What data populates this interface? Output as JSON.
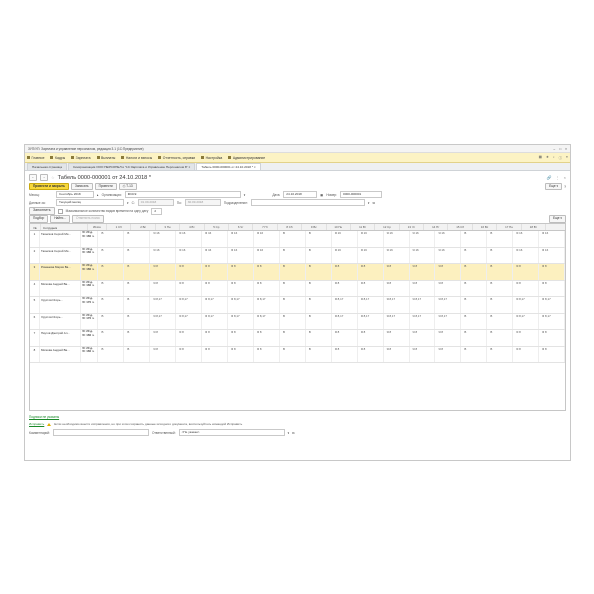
{
  "window": {
    "title": "ЗУП/УП: Зарплата и управление персоналом, редакция 3.1 (1С:Предприятие)"
  },
  "menu": [
    {
      "label": "Главное",
      "icon": "home-icon"
    },
    {
      "label": "Кадры",
      "icon": "people-icon"
    },
    {
      "label": "Зарплата",
      "icon": "wallet-icon"
    },
    {
      "label": "Выплаты",
      "icon": "payment-icon"
    },
    {
      "label": "Налоги и взносы",
      "icon": "tax-icon"
    },
    {
      "label": "Отчетность, справки",
      "icon": "report-icon"
    },
    {
      "label": "Настройка",
      "icon": "wrench-icon"
    },
    {
      "label": "Администрирование",
      "icon": "gear-icon"
    }
  ],
  "tabs": [
    {
      "label": "Начальная страница"
    },
    {
      "label": "Синхронизация ООО ПЕРСОНЕЛ и \"1С:Зарплата и Управление Персоналом 8\" ×"
    },
    {
      "label": "Табель 0000-000001 от 24.10.2018 * ×"
    }
  ],
  "doc": {
    "title": "Табель 0000-000001 от 24.10.2018 *"
  },
  "toolbar": {
    "post_close": "Провести и закрыть",
    "save": "Записать",
    "post": "Провести",
    "t13": "Т-13",
    "more": "Еще"
  },
  "form": {
    "month_label": "Месяц:",
    "month_value": "Сентябрь 2018",
    "org_label": "Организация:",
    "org_value": "ФСКЭ",
    "date_label": "Дата:",
    "date_value": "24.10.2018",
    "number_label": "Номер:",
    "number_value": "0000-000001",
    "data_for_label": "Данные за:",
    "data_for_value": "Текущий месяц",
    "from_label": "С:",
    "from_value": "01.09.2018",
    "to_label": "По:",
    "to_value": "30.09.2018",
    "dept_label": "Подразделение:"
  },
  "fill": {
    "button": "Заполнить",
    "hint": "Максимальное количество видов времени на одну дату"
  },
  "table_tools": {
    "pick": "Подбор",
    "find": "Найти...",
    "cancel_search": "Отменить поиск",
    "more": "Еще"
  },
  "table": {
    "headers": [
      "№",
      "Сотрудник",
      "Итого"
    ],
    "days": [
      {
        "label": "1 Сб",
        "weekend": true
      },
      {
        "label": "2 Вс",
        "weekend": true
      },
      {
        "label": "3 Пн",
        "weekend": false
      },
      {
        "label": "4 Вт",
        "weekend": false
      },
      {
        "label": "5 Ср",
        "weekend": false
      },
      {
        "label": "6 Чт",
        "weekend": false
      },
      {
        "label": "7 Пт",
        "weekend": false
      },
      {
        "label": "8 Сб",
        "weekend": true
      },
      {
        "label": "9 Вс",
        "weekend": true
      },
      {
        "label": "10 Пн",
        "weekend": false
      },
      {
        "label": "11 Вт",
        "weekend": false
      },
      {
        "label": "12 Ср",
        "weekend": false
      },
      {
        "label": "13 Чт",
        "weekend": false
      },
      {
        "label": "14 Пт",
        "weekend": false
      },
      {
        "label": "15 Сб",
        "weekend": true
      },
      {
        "label": "16 Вс",
        "weekend": true
      },
      {
        "label": "17 Пн",
        "weekend": false
      },
      {
        "label": "18 Вт",
        "weekend": false
      }
    ],
    "rows": [
      {
        "num": "1",
        "name": "Таянсков Сергей Ми...",
        "totals": [
          "Я: 20 д.",
          "Я: 160 ч."
        ],
        "code": "Я 16"
      },
      {
        "num": "2",
        "name": "Таянсков Сергей Ми...",
        "totals": [
          "Я: 20 д.",
          "Я: 160 ч."
        ],
        "code": "Я 16"
      },
      {
        "num": "3",
        "name": "Романова Мария Ва...",
        "totals": [
          "Я: 20 д.",
          "Я: 160 ч."
        ],
        "code": "Я 8"
      },
      {
        "num": "4",
        "name": "Мягкова Андрей Ва...",
        "totals": [
          "Я: 20 д.",
          "Я: 160 ч."
        ],
        "code": "Я 8"
      },
      {
        "num": "5",
        "name": "Хрустов Игорь...",
        "totals": [
          "Я: 20 д.",
          "Я: 170 ч."
        ],
        "code": "Я 8,17"
      },
      {
        "num": "6",
        "name": "Хрустов Игорь...",
        "totals": [
          "Я: 20 д.",
          "Я: 170 ч."
        ],
        "code": "Я 8,17"
      },
      {
        "num": "7",
        "name": "Паутов Дмитрий Ал...",
        "totals": [
          "Я: 20 д.",
          "Я: 160 ч."
        ],
        "code": "Я 8"
      },
      {
        "num": "8",
        "name": "Мягкова Андрей Ва...",
        "totals": [
          "Я: 20 д.",
          "Я: 160 ч."
        ],
        "code": "Я 8"
      }
    ],
    "weekend_mark": "В"
  },
  "below": {
    "signatures_link": "Подписи не указаны",
    "fix_link": "Исправить",
    "notice": "Если необходимо внести исправления, но при этом сохранить данные исходного документа, воспользуйтесь командой Исправить"
  },
  "footer": {
    "comment_label": "Комментарий:",
    "resp_label": "Ответственный:",
    "resp_value": "<Не указан>"
  }
}
